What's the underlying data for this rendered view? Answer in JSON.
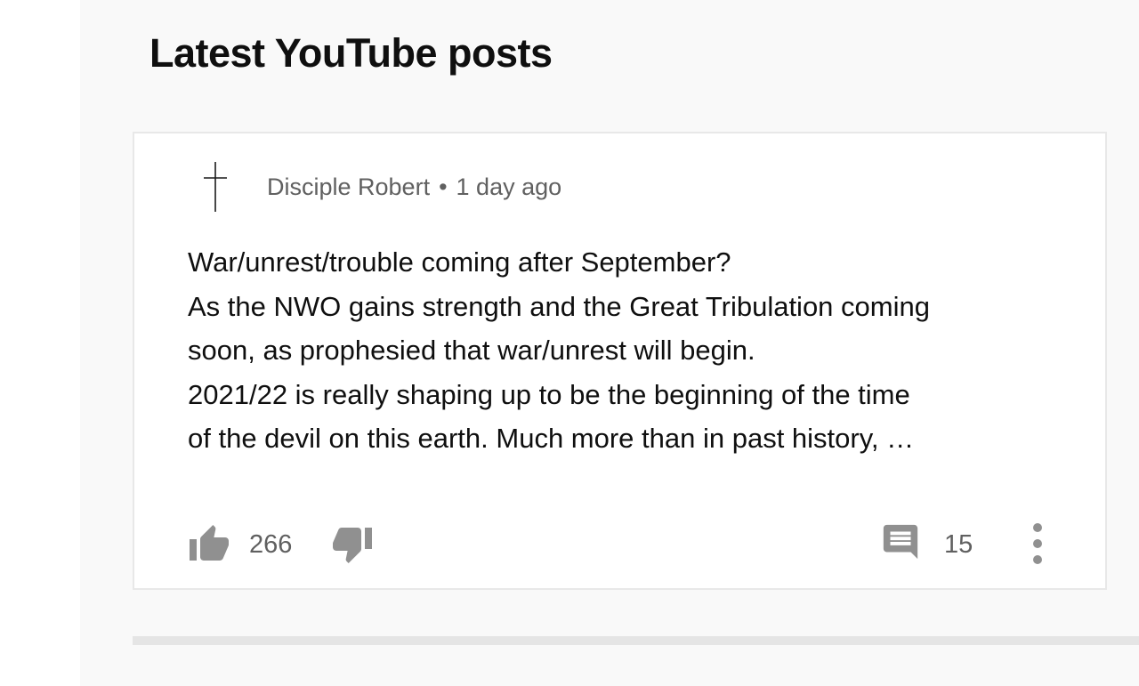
{
  "section": {
    "title": "Latest YouTube posts"
  },
  "post": {
    "author": "Disciple Robert",
    "separator": "•",
    "time": "1 day ago",
    "avatar_icon": "cross-icon",
    "lines": [
      "War/unrest/trouble coming after September?",
      "As the NWO gains strength and the Great Tribulation coming",
      "soon, as prophesied that war/unrest will begin.",
      "2021/22 is really shaping up to be the beginning of the time",
      "of the devil on this earth. Much more than in past history, …"
    ],
    "likes": "266",
    "comments": "15"
  },
  "colors": {
    "text": "#0f0f0f",
    "secondary_text": "#606060",
    "icon": "#909090",
    "background": "#f9f9f9",
    "card": "#ffffff",
    "border": "#e8e8e8"
  }
}
